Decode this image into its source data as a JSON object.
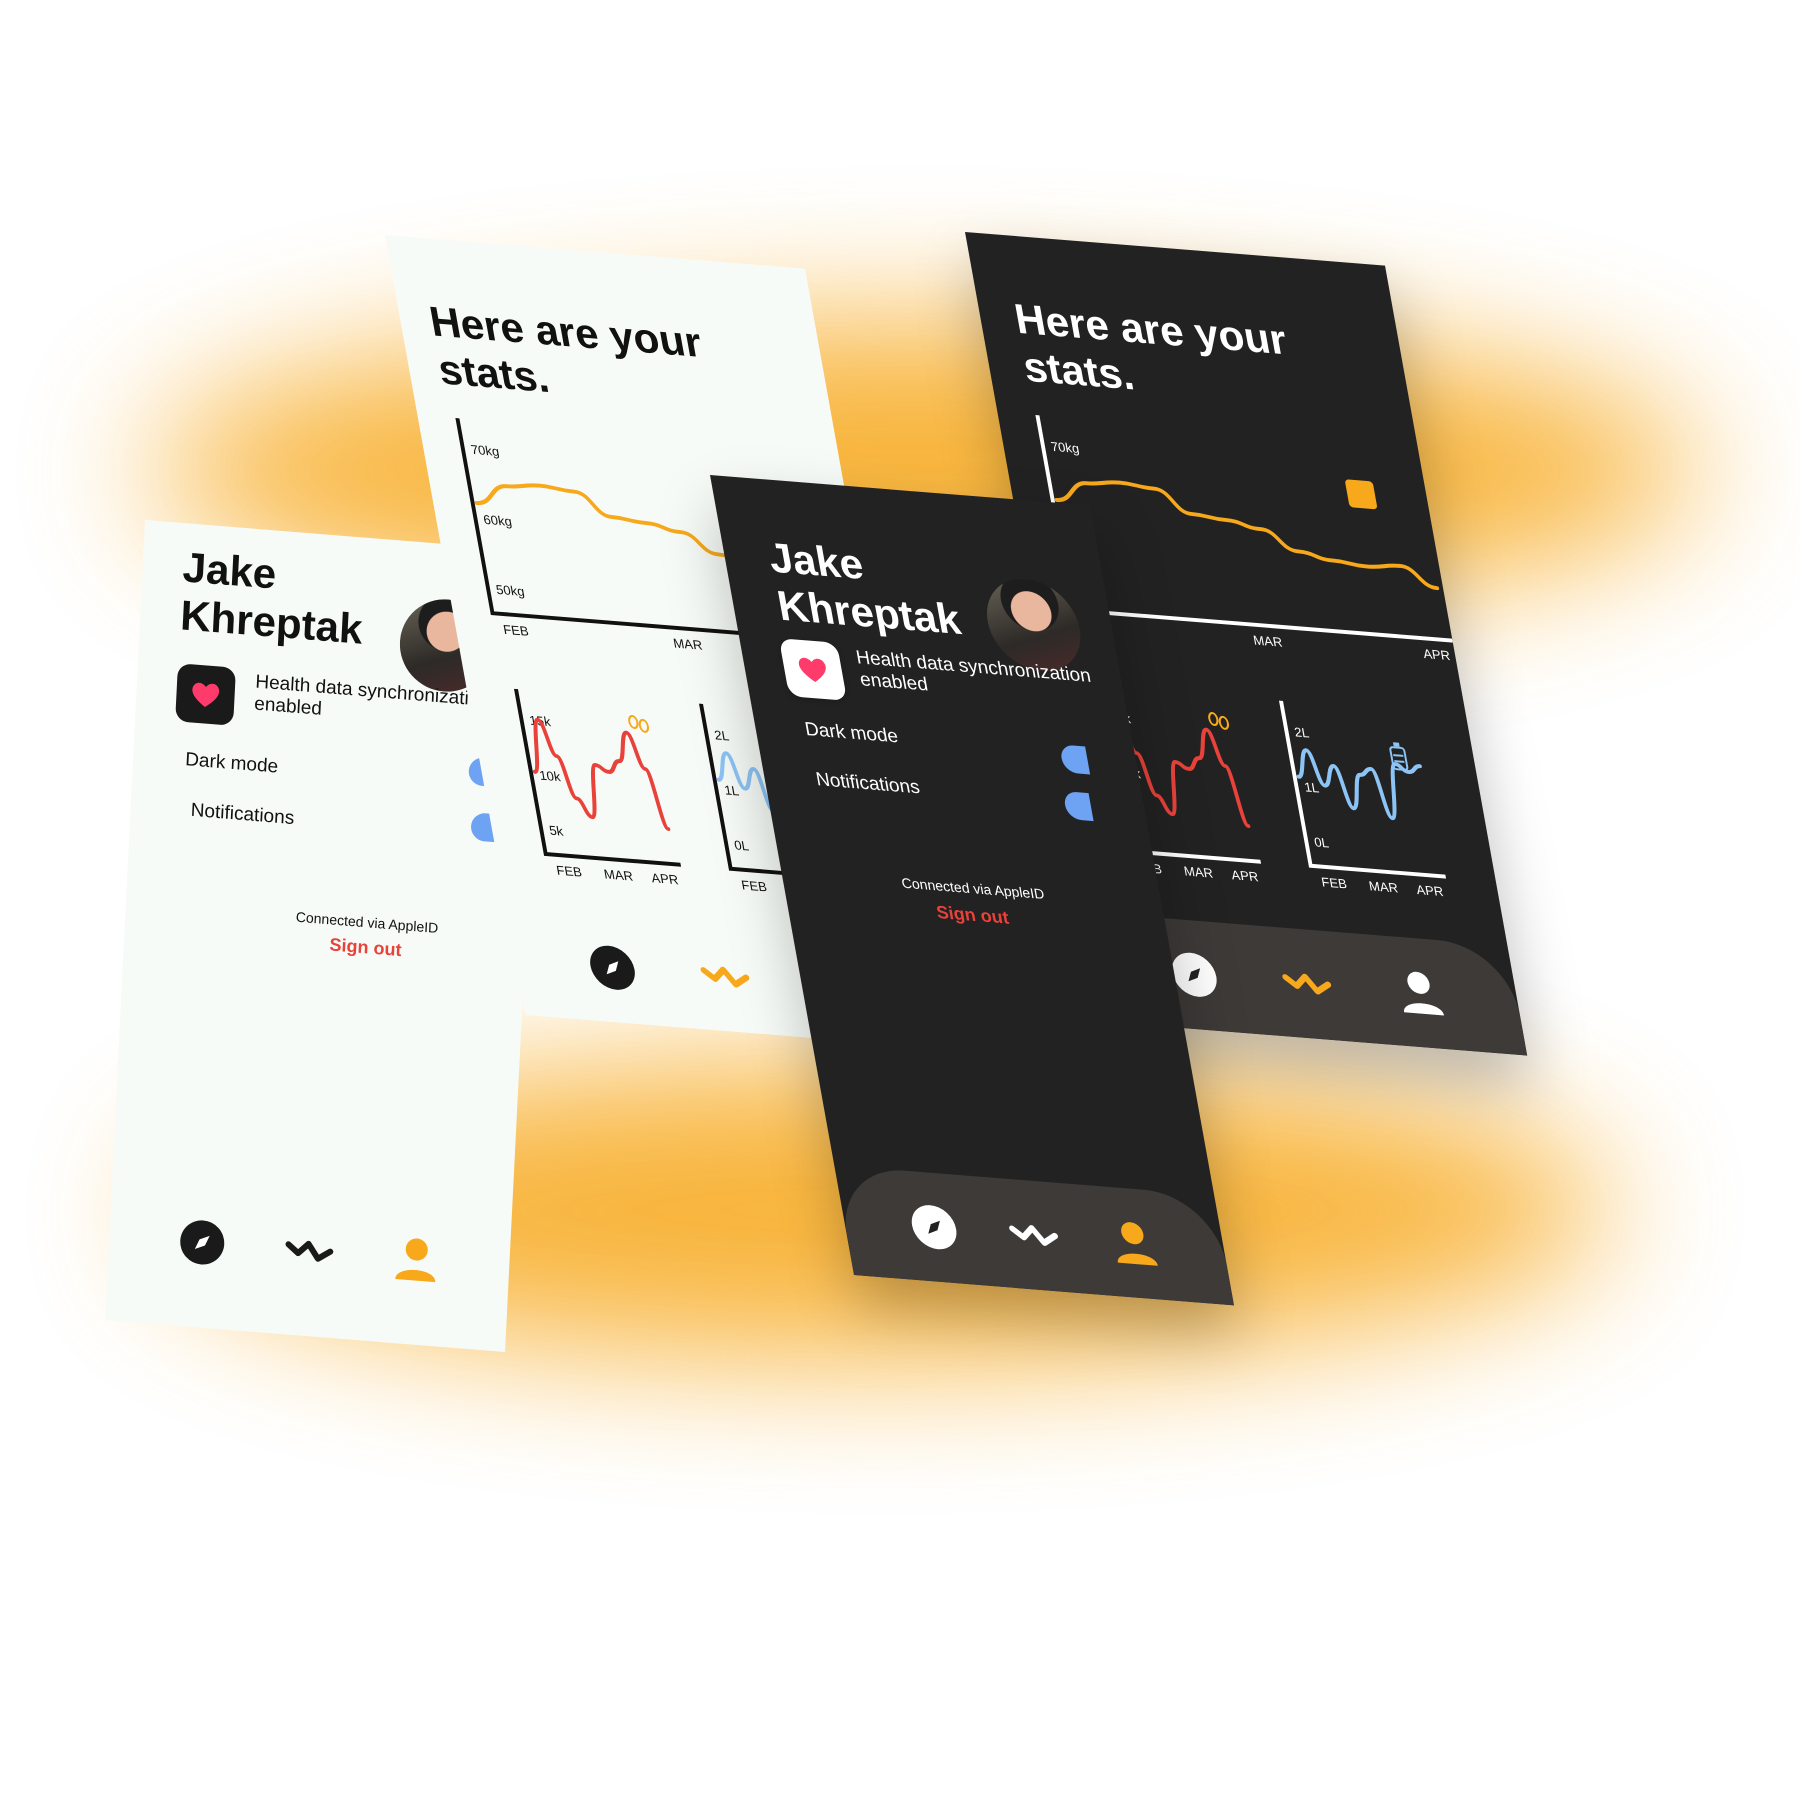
{
  "profile": {
    "first_name": "Jake",
    "last_name": "Khreptak",
    "health_sync_line1": "Health data synchronization",
    "health_sync_line2": "enabled",
    "dark_mode_label": "Dark mode",
    "notifications_label": "Notifications",
    "connected_label": "Connected via AppleID",
    "sign_out_label": "Sign out"
  },
  "stats": {
    "title_line1": "Here are your",
    "title_line2": "stats."
  },
  "colors": {
    "accent": "#f7a81b",
    "steps": "#e8423a",
    "water": "#8cc4f5",
    "toggle": "#6ea2f2",
    "dark_bg": "#222222",
    "light_bg": "#f7fbf7"
  },
  "icons": [
    "heart-icon",
    "compass-icon",
    "stats-wave-icon",
    "person-icon",
    "footsteps-icon",
    "bottle-icon",
    "scale-icon"
  ],
  "chart_data": [
    {
      "type": "line",
      "y_ticks": [
        "70kg",
        "60kg",
        "50kg"
      ],
      "x_ticks": [
        "FEB",
        "MAR",
        "APR"
      ],
      "ylim": [
        45,
        75
      ],
      "series": [
        {
          "values": [
            62,
            65,
            65.5,
            65,
            61.5,
            61,
            60,
            57,
            56,
            55.5,
            56,
            53
          ]
        }
      ]
    },
    {
      "type": "line",
      "y_ticks": [
        "15k",
        "10k",
        "5k"
      ],
      "x_ticks": [
        "FEB",
        "MAR",
        "APR"
      ],
      "ylim": [
        3,
        17
      ],
      "series": [
        {
          "values": [
            10,
            14.5,
            11.5,
            8,
            6.5,
            11,
            10.5,
            11.5,
            14,
            11,
            6
          ]
        }
      ]
    },
    {
      "type": "line",
      "y_ticks": [
        "2L",
        "1L",
        "0L"
      ],
      "x_ticks": [
        "FEB",
        "MAR",
        "APR"
      ],
      "ylim": [
        -0.2,
        2.2
      ],
      "series": [
        {
          "values": [
            1.1,
            1.5,
            1.0,
            1.3,
            0.7,
            1.2,
            1.3,
            0.6,
            1.4,
            1.3,
            1.4
          ]
        }
      ]
    }
  ]
}
